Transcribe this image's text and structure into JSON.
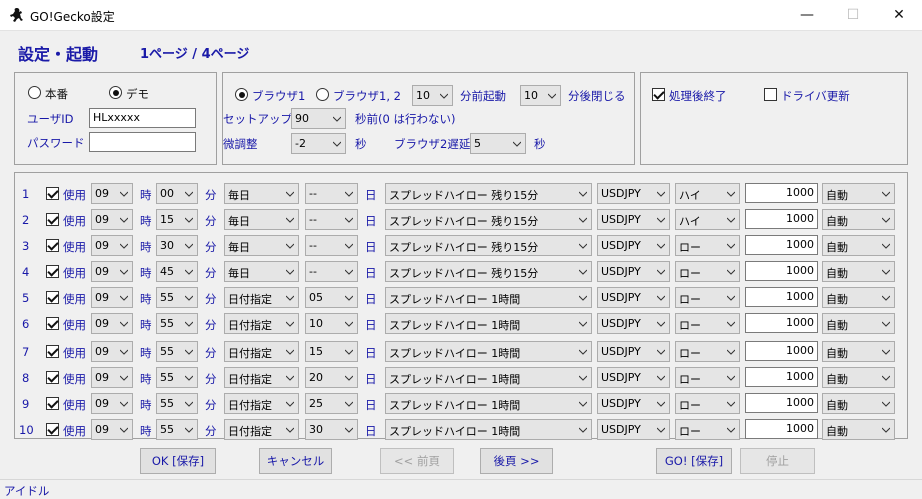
{
  "window": {
    "title": "GO!Gecko設定",
    "minimize": "—",
    "maximize": "☐",
    "close": "✕"
  },
  "header": {
    "title": "設定・起動",
    "page_info": "1ページ / 4ページ"
  },
  "account": {
    "mode_real": "本番",
    "mode_demo": "デモ",
    "mode_selected": "demo",
    "userid_label": "ユーザID",
    "userid_value": "HLxxxxx",
    "password_label": "パスワード",
    "password_value": ""
  },
  "browser": {
    "browser1_label": "ブラウザ1",
    "browser12_label": "ブラウザ1, 2",
    "selected": "browser1",
    "start_before_value": "10",
    "start_before_label": "分前起動",
    "close_after_value": "10",
    "close_after_label": "分後閉じる",
    "setup_label": "セットアップ",
    "setup_value": "90",
    "setup_suffix": "秒前(0 は行わない)",
    "fine_label": "微調整",
    "fine_value": "-2",
    "fine_suffix": "秒",
    "delay_label": "ブラウザ2遅延",
    "delay_value": "5",
    "delay_suffix": "秒"
  },
  "options": {
    "exit_after_label": "処理後終了",
    "exit_after_checked": true,
    "driver_update_label": "ドライバ更新",
    "driver_update_checked": false
  },
  "row_labels": {
    "use": "使用",
    "hour": "時",
    "minute": "分",
    "day": "日"
  },
  "rows": [
    {
      "num": "1",
      "use": true,
      "hour": "09",
      "min": "00",
      "freq": "毎日",
      "day": "--",
      "item": "スプレッドハイロー 残り15分",
      "pair": "USDJPY",
      "dir": "ハイ",
      "amount": "1000",
      "mode": "自動"
    },
    {
      "num": "2",
      "use": true,
      "hour": "09",
      "min": "15",
      "freq": "毎日",
      "day": "--",
      "item": "スプレッドハイロー 残り15分",
      "pair": "USDJPY",
      "dir": "ハイ",
      "amount": "1000",
      "mode": "自動"
    },
    {
      "num": "3",
      "use": true,
      "hour": "09",
      "min": "30",
      "freq": "毎日",
      "day": "--",
      "item": "スプレッドハイロー 残り15分",
      "pair": "USDJPY",
      "dir": "ロー",
      "amount": "1000",
      "mode": "自動"
    },
    {
      "num": "4",
      "use": true,
      "hour": "09",
      "min": "45",
      "freq": "毎日",
      "day": "--",
      "item": "スプレッドハイロー 残り15分",
      "pair": "USDJPY",
      "dir": "ロー",
      "amount": "1000",
      "mode": "自動"
    },
    {
      "num": "5",
      "use": true,
      "hour": "09",
      "min": "55",
      "freq": "日付指定",
      "day": "05",
      "item": "スプレッドハイロー 1時間",
      "pair": "USDJPY",
      "dir": "ロー",
      "amount": "1000",
      "mode": "自動"
    },
    {
      "num": "6",
      "use": true,
      "hour": "09",
      "min": "55",
      "freq": "日付指定",
      "day": "10",
      "item": "スプレッドハイロー 1時間",
      "pair": "USDJPY",
      "dir": "ロー",
      "amount": "1000",
      "mode": "自動"
    },
    {
      "num": "7",
      "use": true,
      "hour": "09",
      "min": "55",
      "freq": "日付指定",
      "day": "15",
      "item": "スプレッドハイロー 1時間",
      "pair": "USDJPY",
      "dir": "ロー",
      "amount": "1000",
      "mode": "自動"
    },
    {
      "num": "8",
      "use": true,
      "hour": "09",
      "min": "55",
      "freq": "日付指定",
      "day": "20",
      "item": "スプレッドハイロー 1時間",
      "pair": "USDJPY",
      "dir": "ロー",
      "amount": "1000",
      "mode": "自動"
    },
    {
      "num": "9",
      "use": true,
      "hour": "09",
      "min": "55",
      "freq": "日付指定",
      "day": "25",
      "item": "スプレッドハイロー 1時間",
      "pair": "USDJPY",
      "dir": "ロー",
      "amount": "1000",
      "mode": "自動"
    },
    {
      "num": "10",
      "use": true,
      "hour": "09",
      "min": "55",
      "freq": "日付指定",
      "day": "30",
      "item": "スプレッドハイロー 1時間",
      "pair": "USDJPY",
      "dir": "ロー",
      "amount": "1000",
      "mode": "自動"
    }
  ],
  "buttons": {
    "ok_save": "OK [保存]",
    "cancel": "キャンセル",
    "prev": "<< 前頁",
    "next": "後頁 >>",
    "go_save": "GO! [保存]",
    "stop": "停止"
  },
  "status": {
    "text": "アイドル"
  },
  "colors": {
    "label_blue": "#1818a8",
    "window_bg": "#f0f0f0"
  }
}
